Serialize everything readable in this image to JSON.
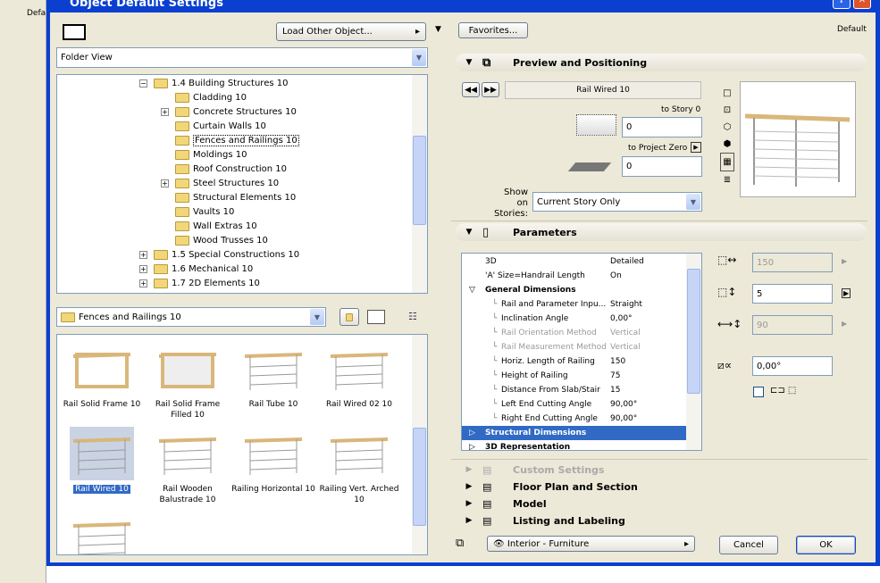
{
  "window": {
    "title": "Object Default Settings",
    "bg_label": "Defa"
  },
  "left": {
    "load_other": "Load Other Object...",
    "view_select": "Folder View",
    "tree": [
      {
        "label": "1.4 Building Structures 10",
        "level": 1,
        "expander": "minus"
      },
      {
        "label": "Cladding 10",
        "level": 2
      },
      {
        "label": "Concrete Structures 10",
        "level": 2,
        "expander": "plus"
      },
      {
        "label": "Curtain Walls 10",
        "level": 2
      },
      {
        "label": "Fences and Railings 10",
        "level": 2,
        "selected": true
      },
      {
        "label": "Moldings 10",
        "level": 2
      },
      {
        "label": "Roof Construction 10",
        "level": 2
      },
      {
        "label": "Steel Structures 10",
        "level": 2,
        "expander": "plus"
      },
      {
        "label": "Structural Elements 10",
        "level": 2
      },
      {
        "label": "Vaults 10",
        "level": 2
      },
      {
        "label": "Wall Extras 10",
        "level": 2
      },
      {
        "label": "Wood Trusses 10",
        "level": 2
      },
      {
        "label": "1.5 Special Constructions 10",
        "level": 1,
        "expander": "plus"
      },
      {
        "label": "1.6 Mechanical 10",
        "level": 1,
        "expander": "plus"
      },
      {
        "label": "1.7 2D Elements 10",
        "level": 1,
        "expander": "plus"
      }
    ],
    "folder_select": "Fences and Railings 10",
    "objects": [
      {
        "label": "Rail Solid Frame 10"
      },
      {
        "label": "Rail Solid Frame Filled 10"
      },
      {
        "label": "Rail Tube 10"
      },
      {
        "label": "Rail Wired 02 10"
      },
      {
        "label": "Rail Wired 10",
        "selected": true
      },
      {
        "label": "Rail Wooden Balustrade 10"
      },
      {
        "label": "Railing Horizontal 10"
      },
      {
        "label": "Railing Vert. Arched 10"
      },
      {
        "label": ""
      }
    ]
  },
  "right": {
    "favorites": "Favorites...",
    "default_label": "Default",
    "preview": {
      "header": "Preview and Positioning",
      "object_name": "Rail Wired 10",
      "to_story_label": "to Story 0",
      "to_story_value": "0",
      "to_project_zero_label": "to Project Zero",
      "to_project_zero_value": "0",
      "show_on_label1": "Show on",
      "show_on_label2": "Stories:",
      "show_on_value": "Current Story Only"
    },
    "parameters": {
      "header": "Parameters",
      "rows": [
        {
          "name": "3D",
          "value": "Detailed",
          "indent": 0
        },
        {
          "name": "'A' Size=Handrail Length",
          "value": "On",
          "indent": 0
        },
        {
          "name": "General Dimensions",
          "value": "",
          "group": "open"
        },
        {
          "name": "Rail and Parameter Inpu...",
          "value": "Straight",
          "indent": 1
        },
        {
          "name": "Inclination Angle",
          "value": "0,00°",
          "indent": 1
        },
        {
          "name": "Rail Orientation Method",
          "value": "Vertical",
          "indent": 1,
          "disabled": true
        },
        {
          "name": "Rail Measurement Method",
          "value": "Vertical",
          "indent": 1,
          "disabled": true
        },
        {
          "name": "Horiz. Length of Railing",
          "value": "150",
          "indent": 1
        },
        {
          "name": "Height of Railing",
          "value": "75",
          "indent": 1
        },
        {
          "name": "Distance From Slab/Stair",
          "value": "15",
          "indent": 1
        },
        {
          "name": "Left End Cutting Angle",
          "value": "90,00°",
          "indent": 1
        },
        {
          "name": "Right End Cutting Angle",
          "value": "90,00°",
          "indent": 1
        },
        {
          "name": "Structural Dimensions",
          "value": "",
          "group": "closed",
          "selected": true
        },
        {
          "name": "3D Representation",
          "value": "",
          "group": "closed"
        }
      ],
      "a_value": "150",
      "b_value": "5",
      "c_value": "90",
      "angle_value": "0,00°"
    },
    "sections": [
      "Custom Settings",
      "Floor Plan and Section",
      "Model",
      "Listing and Labeling"
    ],
    "layer": "Interior - Furniture",
    "cancel": "Cancel",
    "ok": "OK"
  },
  "colors": {
    "selection": "#316ac5",
    "titlebar": "#0a3fd0",
    "dialog_bg": "#ece9d8"
  }
}
